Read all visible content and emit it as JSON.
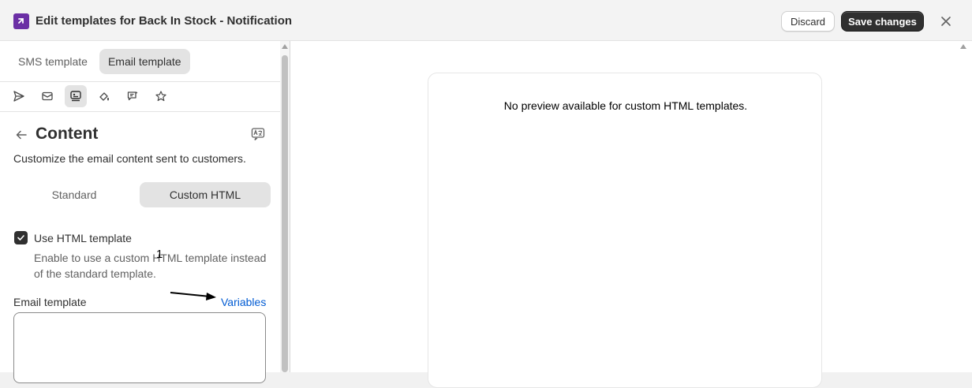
{
  "header": {
    "title": "Edit templates for Back In Stock - Notification",
    "discard_label": "Discard",
    "save_label": "Save changes",
    "logo_icon": "app-logo-icon",
    "close_icon": "close-icon"
  },
  "template_tabs": [
    {
      "label": "SMS template",
      "active": false
    },
    {
      "label": "Email template",
      "active": true
    }
  ],
  "toolbar_icons": [
    "send-icon",
    "email-icon",
    "content-icon",
    "design-icon",
    "feedback-icon",
    "star-icon"
  ],
  "content": {
    "title": "Content",
    "description": "Customize the email content sent to customers.",
    "mode_options": [
      "Standard",
      "Custom HTML"
    ],
    "selected_mode": "Custom HTML",
    "checkbox_label": "Use HTML template",
    "checkbox_checked": true,
    "checkbox_help": "Enable to use a custom HTML template instead of the standard template.",
    "field_label": "Email template",
    "variables_link": "Variables",
    "template_value": ""
  },
  "annotation": {
    "number": "1"
  },
  "preview": {
    "message": "No preview available for custom HTML templates."
  },
  "colors": {
    "primary_button": "#303030",
    "link": "#005bd3",
    "logo": "#6b2fa5"
  }
}
